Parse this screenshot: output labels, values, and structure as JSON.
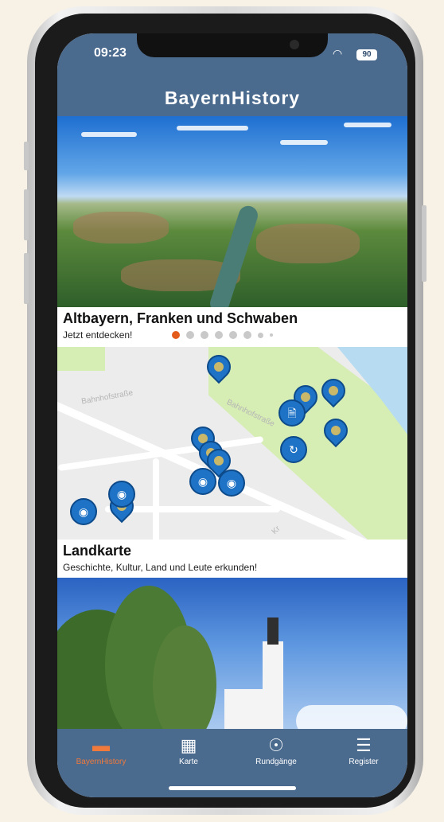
{
  "status": {
    "time": "09:23",
    "battery": "90"
  },
  "app": {
    "title": "BayernHistory"
  },
  "cards": [
    {
      "title": "Altbayern, Franken und Schwaben",
      "subtitle": "Jetzt entdecken!",
      "carousel_pages": 8,
      "active_page": 1
    },
    {
      "title": "Landkarte",
      "subtitle": "Geschichte, Kultur, Land und Leute erkunden!"
    }
  ],
  "map": {
    "streets": [
      "Bahnhofstraße",
      "Bahnhofstraße",
      "Kr"
    ],
    "icons": {
      "pin": "location-pin-icon",
      "camera": "camera-pin-icon",
      "document": "document-pin-icon",
      "panorama": "panorama-pin-icon"
    }
  },
  "tabs": [
    {
      "label": "BayernHistory",
      "icon": "chat-icon",
      "active": true
    },
    {
      "label": "Karte",
      "icon": "map-icon",
      "active": false
    },
    {
      "label": "Rundgänge",
      "icon": "route-icon",
      "active": false
    },
    {
      "label": "Register",
      "icon": "stack-icon",
      "active": false
    }
  ],
  "colors": {
    "bar": "#4a6a8e",
    "accent": "#e35c1c",
    "pin": "#1e73c7"
  }
}
